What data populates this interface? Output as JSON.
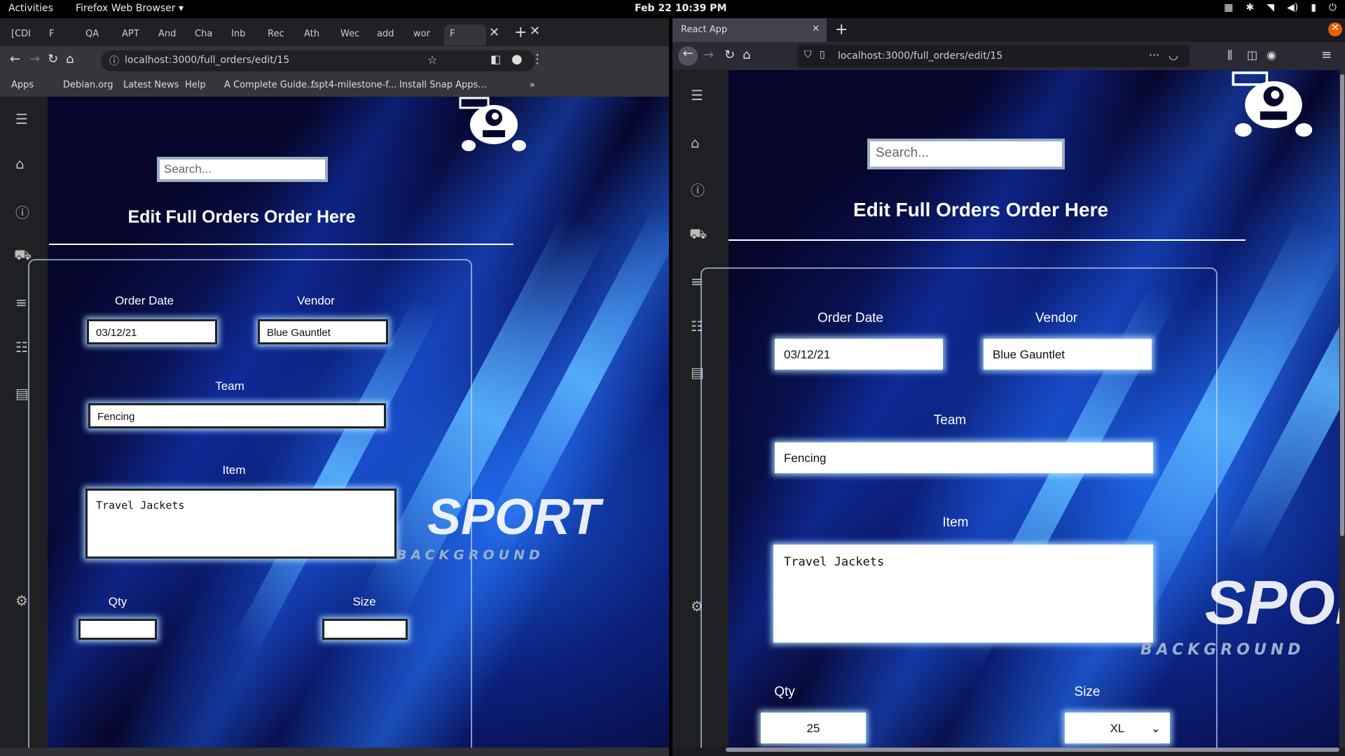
{
  "topbar": {
    "activities": "Activities",
    "app_menu": "Firefox Web Browser ▾",
    "clock": "Feb 22  10:39 PM"
  },
  "left_browser": {
    "tabs": [
      "[CDI",
      "F",
      "QA",
      "APT",
      "And",
      "Cha",
      "Inb",
      "Rec",
      "Ath",
      "Wec",
      "add",
      "wor",
      "F"
    ],
    "url": "localhost:3000/full_orders/edit/15",
    "bookmarks": [
      "Apps",
      "Debian.org",
      "Latest News",
      "Help",
      "A Complete Guide...",
      "fspt4-milestone-f...",
      "Install Snap Apps..."
    ]
  },
  "right_browser": {
    "tab_title": "React App",
    "url": "localhost:3000/full_orders/edit/15"
  },
  "page": {
    "search_placeholder": "Search...",
    "title": "Edit Full Orders Order Here",
    "labels": {
      "order_date": "Order Date",
      "vendor": "Vendor",
      "team": "Team",
      "item": "Item",
      "qty": "Qty",
      "size": "Size"
    },
    "values": {
      "order_date": "03/12/21",
      "vendor": "Blue Gauntlet",
      "team": "Fencing",
      "item": "Travel Jackets",
      "qty": "25",
      "size": "XL"
    },
    "background_text": {
      "sport": "SPORT",
      "background": "BACKGROUND"
    }
  },
  "colors": {
    "sidebar": "#1f2023",
    "page_bg": "#05031a",
    "accent": "#1a5ad8"
  }
}
